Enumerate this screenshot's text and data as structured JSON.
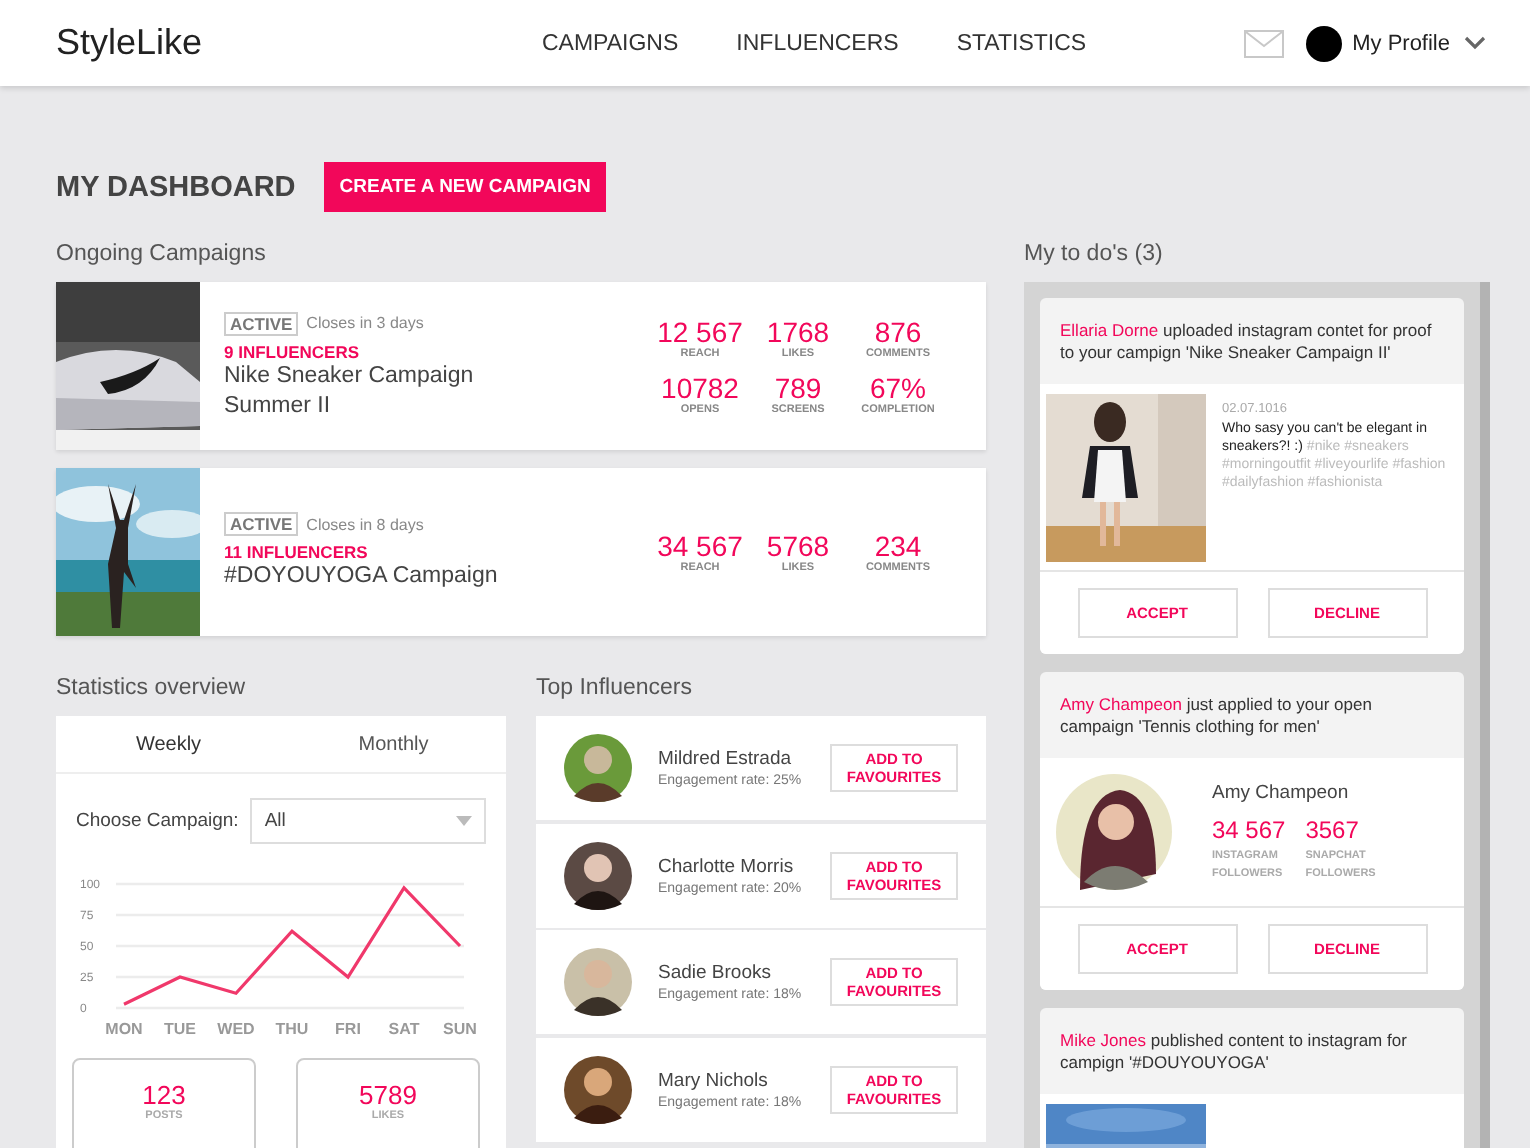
{
  "header": {
    "logo": "StyleLike",
    "nav": [
      {
        "label": "CAMPAIGNS"
      },
      {
        "label": "INFLUENCERS"
      },
      {
        "label": "STATISTICS"
      }
    ],
    "profile": "My Profile"
  },
  "dashboard": {
    "title": "MY DASHBOARD",
    "create_button": "CREATE A NEW CAMPAIGN"
  },
  "ongoing": {
    "title": "Ongoing Campaigns",
    "campaigns": [
      {
        "status": "ACTIVE",
        "closes": "Closes in 3 days",
        "influencers": "9 INFLUENCERS",
        "name": "Nike Sneaker Campaign Summer II",
        "stats": [
          {
            "value": "12 567",
            "label": "REACH"
          },
          {
            "value": "1768",
            "label": "LIKES"
          },
          {
            "value": "876",
            "label": "COMMENTS"
          },
          {
            "value": "10782",
            "label": "OPENS"
          },
          {
            "value": "789",
            "label": "SCREENS"
          },
          {
            "value": "67%",
            "label": "COMPLETION"
          }
        ]
      },
      {
        "status": "ACTIVE",
        "closes": "Closes in 8 days",
        "influencers": "11 INFLUENCERS",
        "name": "#DOYOUYOGA Campaign",
        "stats": [
          {
            "value": "34 567",
            "label": "REACH"
          },
          {
            "value": "5768",
            "label": "LIKES"
          },
          {
            "value": "234",
            "label": "COMMENTS"
          }
        ]
      }
    ]
  },
  "statistics": {
    "title": "Statistics overview",
    "tabs": [
      {
        "label": "Weekly",
        "selected": true
      },
      {
        "label": "Monthly",
        "selected": false
      }
    ],
    "campaign_label": "Choose Campaign:",
    "campaign_value": "All",
    "chart_data": {
      "type": "line",
      "categories": [
        "MON",
        "TUE",
        "WED",
        "THU",
        "FRI",
        "SAT",
        "SUN"
      ],
      "series": [
        {
          "color": "#f0386b",
          "values": [
            3,
            25,
            12,
            62,
            25,
            97,
            50
          ]
        }
      ],
      "ylim": [
        0,
        100
      ],
      "yticks": [
        0,
        25,
        50,
        75,
        100
      ],
      "grid": true
    },
    "totals": [
      {
        "value": "123",
        "label": "POSTS"
      },
      {
        "value": "5789",
        "label": "LIKES"
      }
    ]
  },
  "influencers": {
    "title": "Top Influencers",
    "items": [
      {
        "name": "Mildred Estrada",
        "rate": "Engagement rate: 25%",
        "button": "ADD TO FAVOURITES"
      },
      {
        "name": "Charlotte Morris",
        "rate": "Engagement rate: 20%",
        "button": "ADD TO FAVOURITES"
      },
      {
        "name": "Sadie Brooks",
        "rate": "Engagement rate: 18%",
        "button": "ADD TO FAVOURITES"
      },
      {
        "name": "Mary Nichols",
        "rate": "Engagement rate: 18%",
        "button": "ADD TO FAVOURITES"
      }
    ]
  },
  "todos": {
    "title": "My to do's (3)",
    "items": [
      {
        "kind": "post",
        "actor": "Ellaria Dorne",
        "text": "uploaded instagram contet for proof to your campign 'Nike Sneaker Campaign II'",
        "date": "02.07.1016",
        "caption": "Who sasy you can't be elegant in sneakers?! :)",
        "tags": "#nike #sneakers #morningoutfit #liveyourlife #fashion #dailyfashion #fashionista",
        "actions": [
          "ACCEPT",
          "DECLINE"
        ]
      },
      {
        "kind": "application",
        "actor": "Amy Champeon",
        "text": "just applied to your open campaign 'Tennis clothing for men'",
        "profile_name": "Amy Champeon",
        "profile_stats": [
          {
            "value": "34 567",
            "label": "INSTAGRAM FOLLOWERS"
          },
          {
            "value": "3567",
            "label": "SNAPCHAT FOLLOWERS"
          }
        ],
        "actions": [
          "ACCEPT",
          "DECLINE"
        ]
      },
      {
        "kind": "post",
        "actor": "Mike Jones",
        "text": "published content to instagram for campign '#DOUYOUYOGA'"
      }
    ]
  }
}
